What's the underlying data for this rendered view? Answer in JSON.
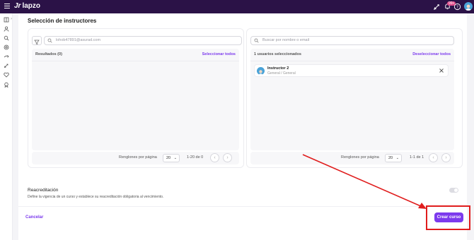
{
  "app": {
    "logo_text": "lapzo",
    "logo_mark": "Jr",
    "notification_count": "99+"
  },
  "section": {
    "title": "Selección de instructores"
  },
  "left_panel": {
    "search_placeholder": "lohob47891@asurad.com",
    "results_label": "Resultados (0)",
    "action_label": "Seleccionar todos",
    "pager": {
      "rows_label": "Renglones por página",
      "rows_value": "20",
      "range": "1-20 de 0"
    }
  },
  "right_panel": {
    "search_placeholder": "Buscar por nombre o email",
    "results_label": "1 usuarios seleccionados",
    "action_label": "Deseleccionar todos",
    "items": [
      {
        "name": "Instructor 2",
        "subtitle": "General / General"
      }
    ],
    "pager": {
      "rows_label": "Renglones por página",
      "rows_value": "20",
      "range": "1-1 de 1"
    }
  },
  "reacreditation": {
    "title": "Reacreditación",
    "description": "Define la vigencia de un curso y establece su reacreditación obligatoria al vencimiento.",
    "enabled": false
  },
  "footer": {
    "cancel_label": "Cancelar",
    "create_label": "Crear curso"
  },
  "colors": {
    "accent": "#7c3aed",
    "topbar": "#2b1247",
    "annotation": "#e01d1d"
  },
  "icons": {
    "topbar": [
      "menu-icon",
      "rocket-icon",
      "bell-icon",
      "help-icon",
      "user-avatar"
    ],
    "rail": [
      "book-icon",
      "person-icon",
      "search-icon",
      "target-icon",
      "share-icon",
      "rocket-icon",
      "heart-icon",
      "award-icon"
    ]
  }
}
